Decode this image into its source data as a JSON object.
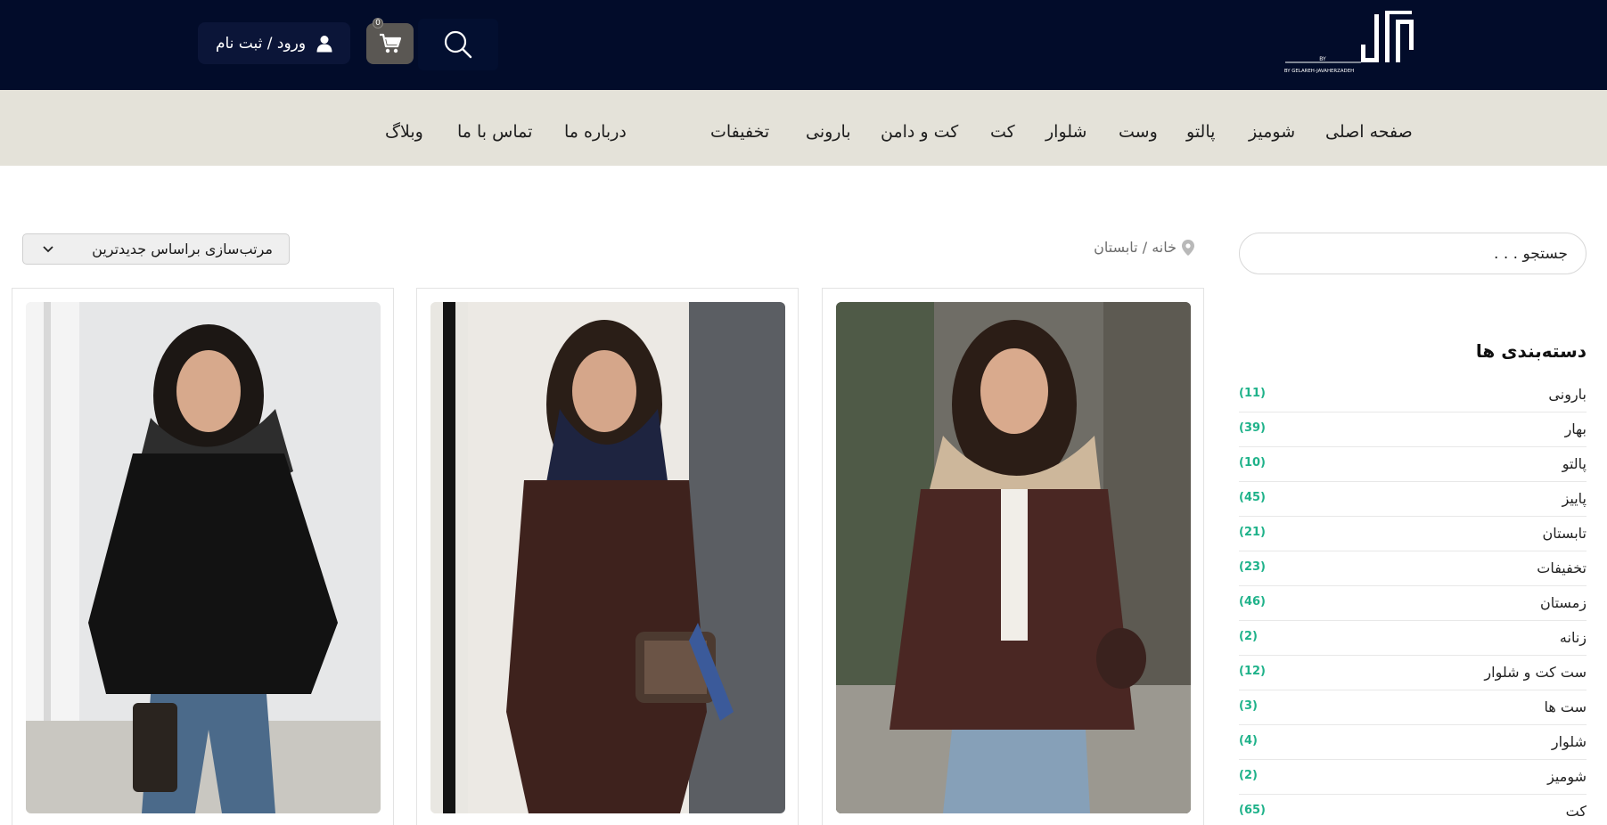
{
  "header": {
    "logo_text": "BY GELAREH-JAVAHERZADEH",
    "login_label": "ورود / ثبت نام",
    "cart_count": "0",
    "icons": {
      "search": "search-icon",
      "cart": "cart-icon",
      "user": "user-icon"
    }
  },
  "nav": {
    "items": [
      "صفحه اصلی",
      "شومیز",
      "پالتو",
      "وست",
      "شلوار",
      "کت",
      "کت و دامن",
      "بارونی",
      "تخفیفات",
      "درباره ما",
      "تماس با ما",
      "وبلاگ"
    ]
  },
  "sidebar": {
    "search_placeholder": "جستجو . . .",
    "categories_title": "دسته‌بندی ها",
    "categories": [
      {
        "name": "بارونی",
        "count": "(11)"
      },
      {
        "name": "بهار",
        "count": "(39)"
      },
      {
        "name": "پالتو",
        "count": "(10)"
      },
      {
        "name": "پاییز",
        "count": "(45)"
      },
      {
        "name": "تابستان",
        "count": "(21)"
      },
      {
        "name": "تخفیفات",
        "count": "(23)"
      },
      {
        "name": "زمستان",
        "count": "(46)"
      },
      {
        "name": "زنانه",
        "count": "(2)"
      },
      {
        "name": "ست کت و شلوار",
        "count": "(12)"
      },
      {
        "name": "ست ها",
        "count": "(3)"
      },
      {
        "name": "شلوار",
        "count": "(4)"
      },
      {
        "name": "شومیز",
        "count": "(2)"
      },
      {
        "name": "کت",
        "count": "(65)"
      }
    ]
  },
  "main": {
    "breadcrumb": "خانه / تابستان",
    "sort_label": "مرتب‌سازی براساس جدیدترین"
  },
  "products": [
    {
      "image": "woman-black-blazer-jeans-photo"
    },
    {
      "image": "woman-brown-suit-navy-scarf-photo"
    },
    {
      "image": "woman-burgundy-blazer-beige-scarf-photo"
    }
  ],
  "colors": {
    "header_bg": "#020c2a",
    "nav_bg": "#e4e2d9",
    "accent_count": "#1fb28a",
    "cart_bg": "#5a5753"
  }
}
